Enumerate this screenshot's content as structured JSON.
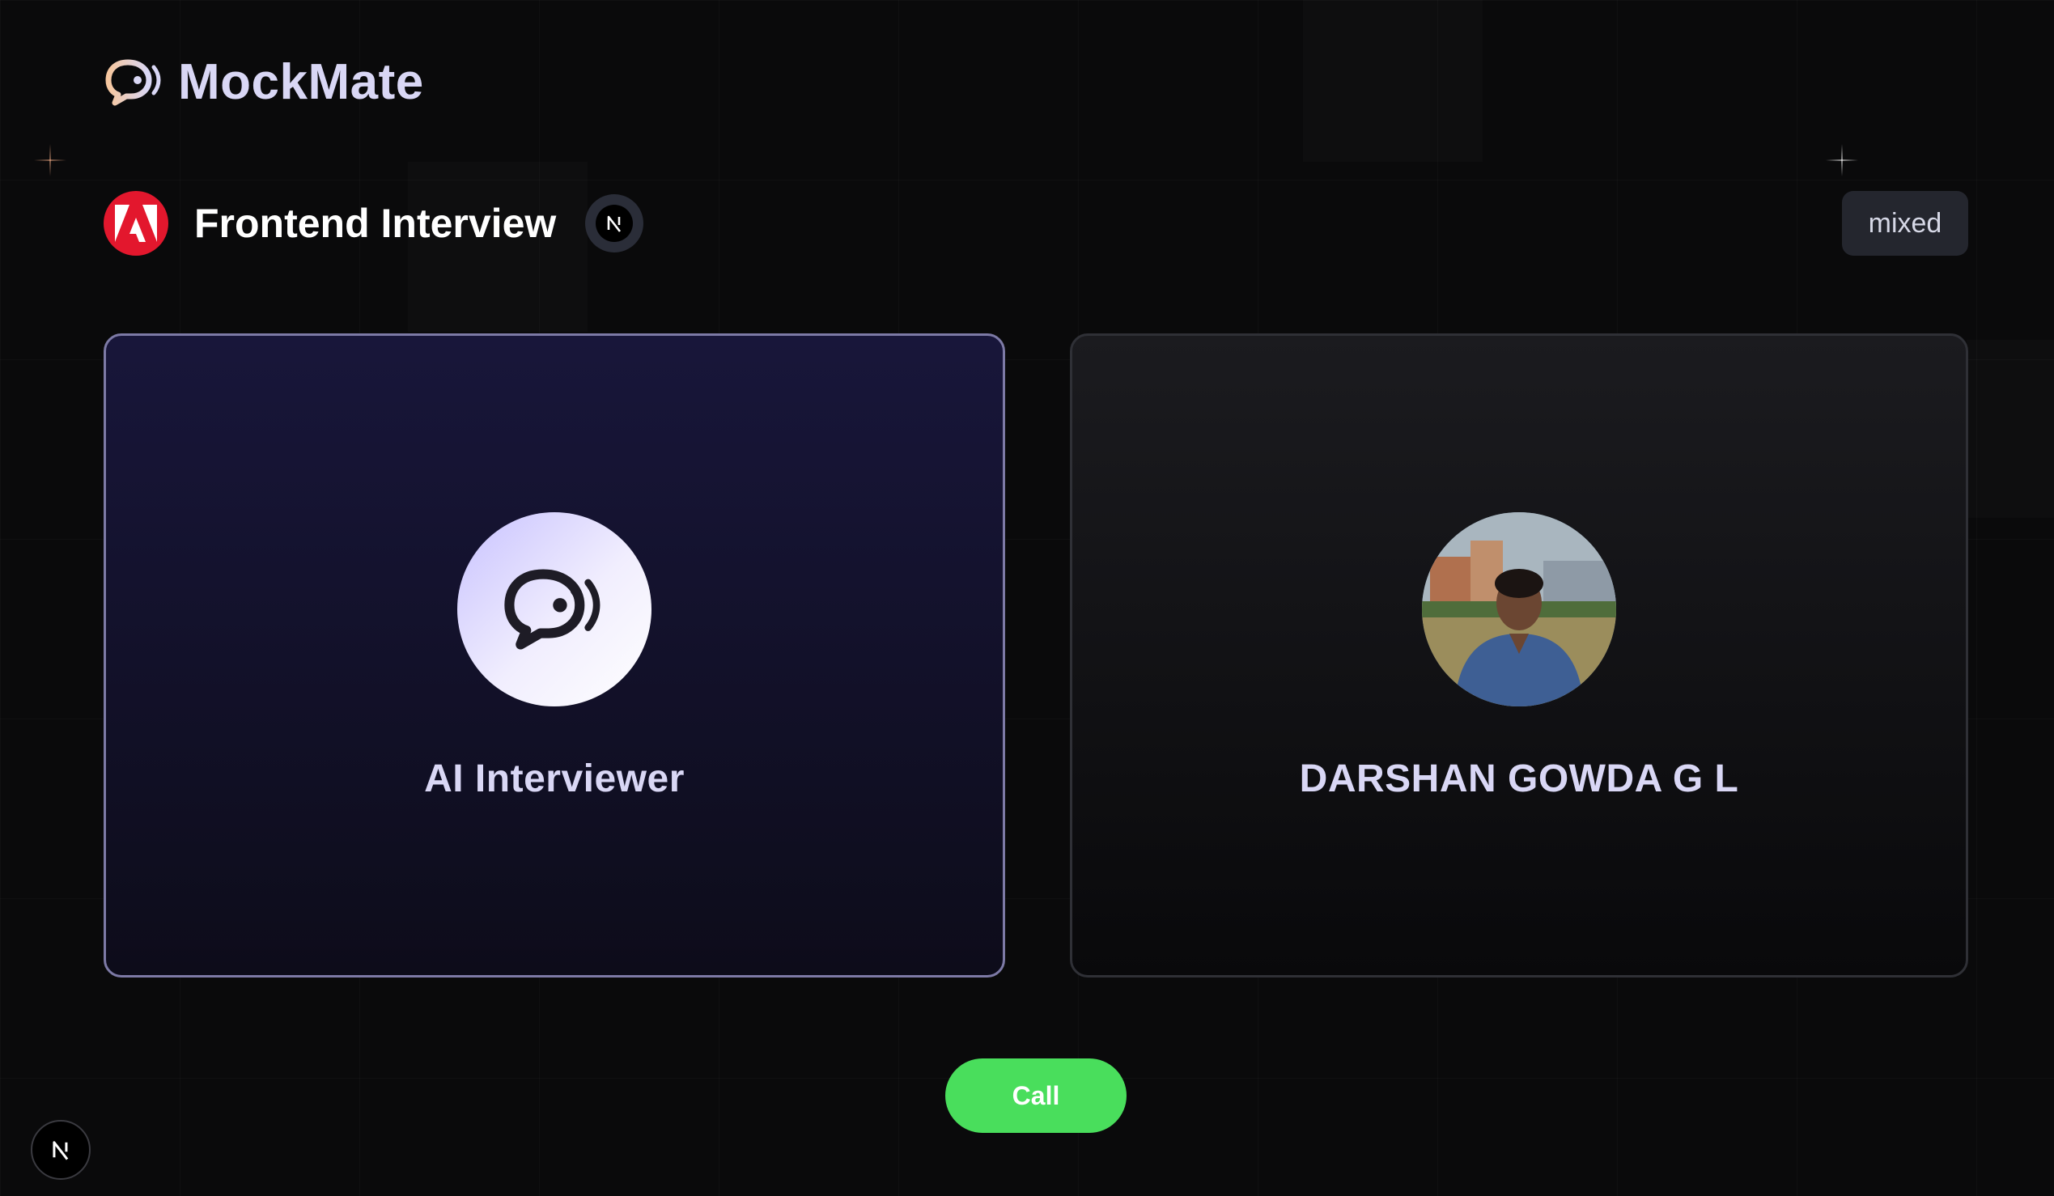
{
  "app": {
    "name": "MockMate",
    "logo_icon": "chat-bubble-audio-icon"
  },
  "interview": {
    "title": "Frontend Interview",
    "company_icon": "adobe-logo-icon",
    "company_color": "#e3172d",
    "tech_icon": "nextjs-logo-icon",
    "type": "mixed"
  },
  "interviewer": {
    "name": "AI Interviewer",
    "icon": "chat-bubble-audio-icon"
  },
  "candidate": {
    "name": "DARSHAN GOWDA G L",
    "avatar": "user-photo"
  },
  "actions": {
    "call_label": "Call",
    "call_color": "#49de5c"
  },
  "footer": {
    "dev_badge_icon": "nextjs-logo-icon"
  },
  "colors": {
    "background": "#0a0a0b",
    "accent_text": "#d9d7f5",
    "ai_card_border": "#7d7aa6"
  }
}
